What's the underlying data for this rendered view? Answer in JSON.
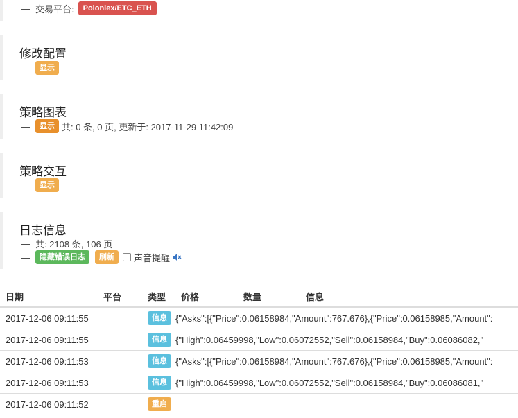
{
  "platform": {
    "label": "交易平台:",
    "value": "Poloniex/ETC_ETH"
  },
  "modify_config": {
    "title": "修改配置",
    "show_label": "显示"
  },
  "strategy_chart": {
    "title": "策略图表",
    "show_label": "显示",
    "summary": "共: 0 条, 0 页, 更新于: 2017-11-29 11:42:09"
  },
  "strategy_interaction": {
    "title": "策略交互",
    "show_label": "显示"
  },
  "log_info": {
    "title": "日志信息",
    "summary": "共: 2108 条, 106 页",
    "hide_errors_label": "隐藏错误日志",
    "refresh_label": "刷新",
    "sound_alert_label": "声音提醒",
    "sound_alert_checked": false
  },
  "dash": "—",
  "log_table": {
    "headers": {
      "date": "日期",
      "platform": "平台",
      "type": "类型",
      "price": "价格",
      "amount": "数量",
      "info": "信息"
    },
    "rows": [
      {
        "date": "2017-12-06 09:11:55",
        "platform": "",
        "type": "信息",
        "type_color": "#5bc0de",
        "message": "{\"Asks\":[{\"Price\":0.06158984,\"Amount\":767.676},{\"Price\":0.06158985,\"Amount\":"
      },
      {
        "date": "2017-12-06 09:11:55",
        "platform": "",
        "type": "信息",
        "type_color": "#5bc0de",
        "message": "{\"High\":0.06459998,\"Low\":0.06072552,\"Sell\":0.06158984,\"Buy\":0.06086082,\""
      },
      {
        "date": "2017-12-06 09:11:53",
        "platform": "",
        "type": "信息",
        "type_color": "#5bc0de",
        "message": "{\"Asks\":[{\"Price\":0.06158984,\"Amount\":767.676},{\"Price\":0.06158985,\"Amount\":"
      },
      {
        "date": "2017-12-06 09:11:53",
        "platform": "",
        "type": "信息",
        "type_color": "#5bc0de",
        "message": "{\"High\":0.06459998,\"Low\":0.06072552,\"Sell\":0.06158984,\"Buy\":0.06086081,\""
      },
      {
        "date": "2017-12-06 09:11:52",
        "platform": "",
        "type": "重启",
        "type_color": "#f0ad4e",
        "message": ""
      }
    ]
  }
}
